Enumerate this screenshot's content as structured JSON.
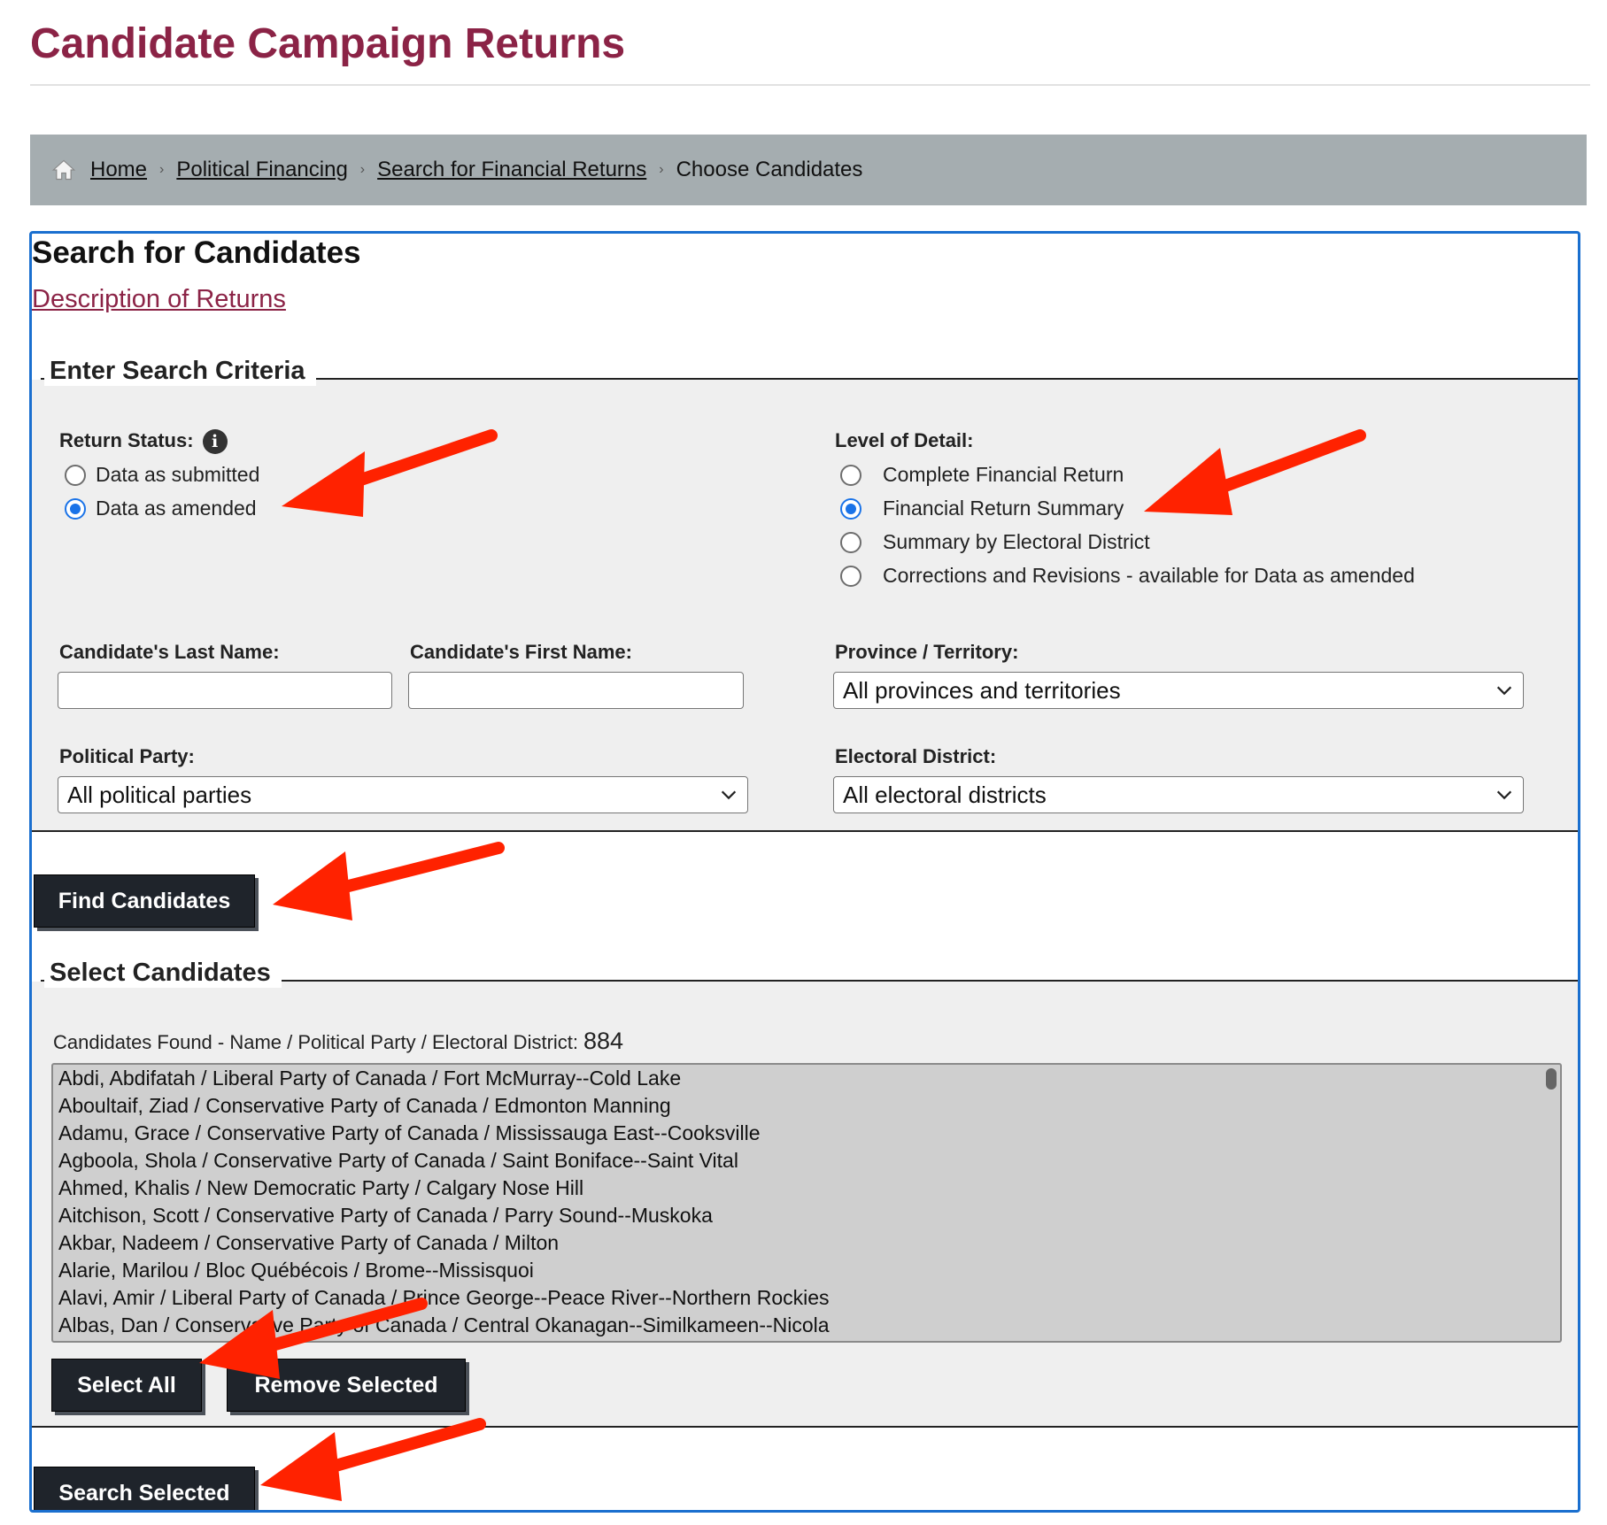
{
  "page_title": "Candidate Campaign Returns",
  "breadcrumb": {
    "home": "Home",
    "political_financing": "Political Financing",
    "search_returns": "Search for Financial Returns",
    "current": "Choose Candidates"
  },
  "panel": {
    "title": "Search for Candidates",
    "description_link": "Description of Returns"
  },
  "criteria": {
    "legend": "Enter Search Criteria",
    "return_status": {
      "label": "Return Status:",
      "options": [
        "Data as submitted",
        "Data as amended"
      ],
      "selected": "Data as amended"
    },
    "level_of_detail": {
      "label": "Level of Detail:",
      "options": [
        "Complete Financial Return",
        "Financial Return Summary",
        "Summary by Electoral District",
        "Corrections and Revisions - available for Data as amended"
      ],
      "selected": "Financial Return Summary"
    },
    "last_name": {
      "label": "Candidate's Last Name:",
      "value": ""
    },
    "first_name": {
      "label": "Candidate's First Name:",
      "value": ""
    },
    "province": {
      "label": "Province / Territory:",
      "value": "All provinces and territories"
    },
    "party": {
      "label": "Political Party:",
      "value": "All political parties"
    },
    "district": {
      "label": "Electoral District:",
      "value": "All electoral districts"
    }
  },
  "find_button": "Find Candidates",
  "select": {
    "legend": "Select Candidates",
    "found_label": "Candidates Found - Name / Political Party / Electoral District:",
    "found_count": "884",
    "candidates": [
      "Abdi, Abdifatah / Liberal Party of Canada / Fort McMurray--Cold Lake",
      "Aboultaif, Ziad / Conservative Party of Canada / Edmonton Manning",
      "Adamu, Grace / Conservative Party of Canada / Mississauga East--Cooksville",
      "Agboola, Shola / Conservative Party of Canada / Saint Boniface--Saint Vital",
      "Ahmed, Khalis / New Democratic Party / Calgary Nose Hill",
      "Aitchison, Scott / Conservative Party of Canada / Parry Sound--Muskoka",
      "Akbar, Nadeem / Conservative Party of Canada / Milton",
      "Alarie, Marilou / Bloc Québécois / Brome--Missisquoi",
      "Alavi, Amir / Liberal Party of Canada / Prince George--Peace River--Northern Rockies",
      "Albas, Dan / Conservative Party of Canada / Central Okanagan--Similkameen--Nicola"
    ],
    "select_all": "Select All",
    "remove_selected": "Remove Selected"
  },
  "search_button": "Search Selected",
  "colors": {
    "brand": "#8b2346",
    "breadcrumb_bg": "#a5adb0",
    "panel_border": "#1a6fcf",
    "button_bg": "#1f242b",
    "annotation_arrow": "#ff2200"
  }
}
